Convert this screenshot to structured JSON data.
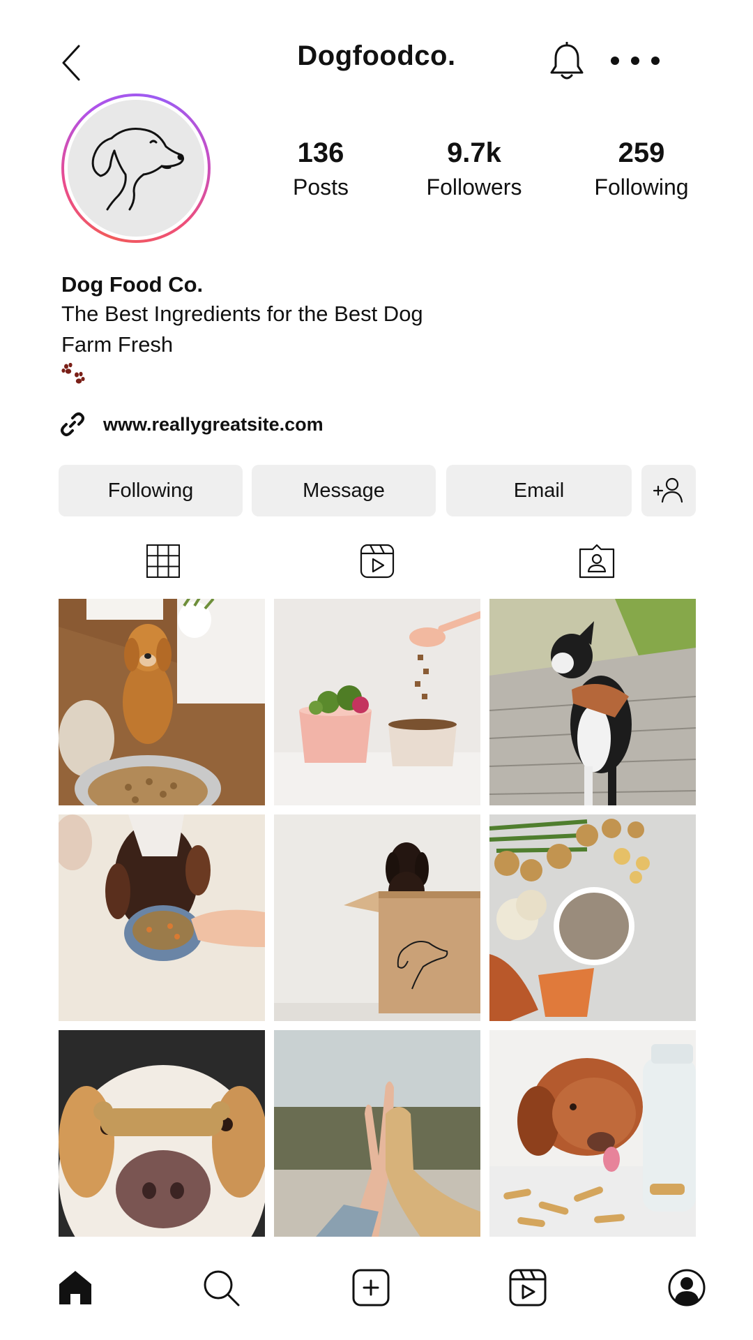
{
  "header": {
    "title": "Dogfoodco.",
    "back_icon": "chevron-left-icon",
    "notifications_icon": "bell-icon",
    "more_icon": "more-horizontal-icon"
  },
  "profile": {
    "avatar_icon": "dog-logo-icon",
    "stats": {
      "posts": {
        "value": "136",
        "label": "Posts"
      },
      "followers": {
        "value": "9.7k",
        "label": "Followers"
      },
      "following": {
        "value": "259",
        "label": "Following"
      }
    },
    "name": "Dog Food Co.",
    "bio_lines": [
      "The Best Ingredients for the Best Dog",
      "Farm Fresh"
    ],
    "bio_emoji_icon": "paw-prints-icon",
    "website": "www.reallygreatsite.com"
  },
  "actions": {
    "following_label": "Following",
    "message_label": "Message",
    "email_label": "Email",
    "add_user_icon": "add-user-icon"
  },
  "tabs": [
    "grid-icon",
    "reels-icon",
    "tagged-icon"
  ],
  "posts": [
    {
      "id": "golden-retriever-with-bowl"
    },
    {
      "id": "food-bowls-with-scoop"
    },
    {
      "id": "boston-terrier-on-boardwalk"
    },
    {
      "id": "dog-eating-from-blue-bowl"
    },
    {
      "id": "dachshund-in-box"
    },
    {
      "id": "vegetables-and-food-bowl"
    },
    {
      "id": "treat-on-dog-nose"
    },
    {
      "id": "high-five-paw"
    },
    {
      "id": "dog-licking-treats"
    }
  ],
  "bottom_nav": [
    "home-icon",
    "search-icon",
    "create-icon",
    "reels-icon",
    "profile-icon"
  ],
  "colors": {
    "button_bg": "#efefef",
    "avatar_ring_start": "#f15b5b",
    "avatar_ring_end": "#9c5cf2",
    "paw_color": "#7a1f17"
  }
}
